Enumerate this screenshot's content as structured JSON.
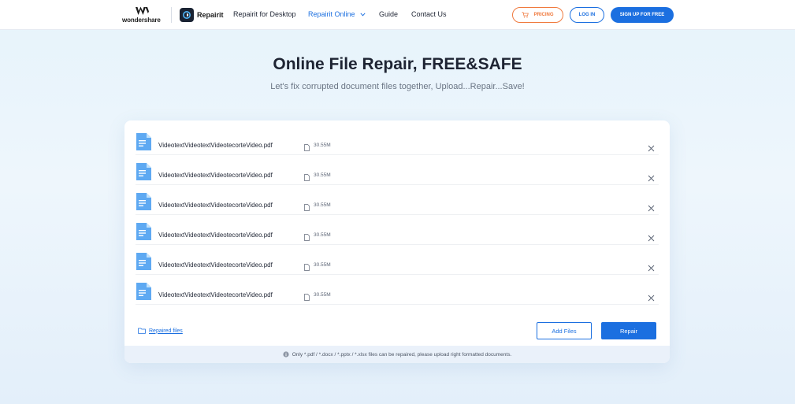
{
  "header": {
    "brand": "wondershare",
    "product": "Repairit",
    "nav": [
      {
        "label": "Repairit for Desktop"
      },
      {
        "label": "Repairit Online"
      },
      {
        "label": "Guide"
      },
      {
        "label": "Contact Us"
      }
    ],
    "pricing_label": "PRICING",
    "login_label": "LOG IN",
    "signup_label": "SIGN UP FOR FREE"
  },
  "hero": {
    "title": "Online File Repair, FREE&SAFE",
    "subtitle": "Let's fix corrupted document files together, Upload...Repair...Save!"
  },
  "files": [
    {
      "name": "VideotextVideotextVideotecorteVideo.pdf",
      "size": "30.55M"
    },
    {
      "name": "VideotextVideotextVideotecorteVideo.pdf",
      "size": "30.55M"
    },
    {
      "name": "VideotextVideotextVideotecorteVideo.pdf",
      "size": "30.55M"
    },
    {
      "name": "VideotextVideotextVideotecorteVideo.pdf",
      "size": "30.55M"
    },
    {
      "name": "VideotextVideotextVideotecorteVideo.pdf",
      "size": "30.55M"
    },
    {
      "name": "VideotextVideotextVideotecorteVideo.pdf",
      "size": "30.55M"
    }
  ],
  "footer": {
    "repaired_label": "Repaired files",
    "add_label": "Add Files",
    "repair_label": "Repair",
    "note": "Only *.pdf / *.docx / *.pptx / *.xlsx files can be repaired,  please upload right formatted documents."
  },
  "icons": [
    "wondershare-logo-icon",
    "repairit-app-icon",
    "chevron-down-icon",
    "cart-icon",
    "document-icon",
    "file-size-icon",
    "close-icon",
    "folder-icon",
    "info-icon"
  ],
  "colors": {
    "accent": "#1b6fe0",
    "pricing": "#f07a3e",
    "doc_icon": "#5ea9f2"
  }
}
